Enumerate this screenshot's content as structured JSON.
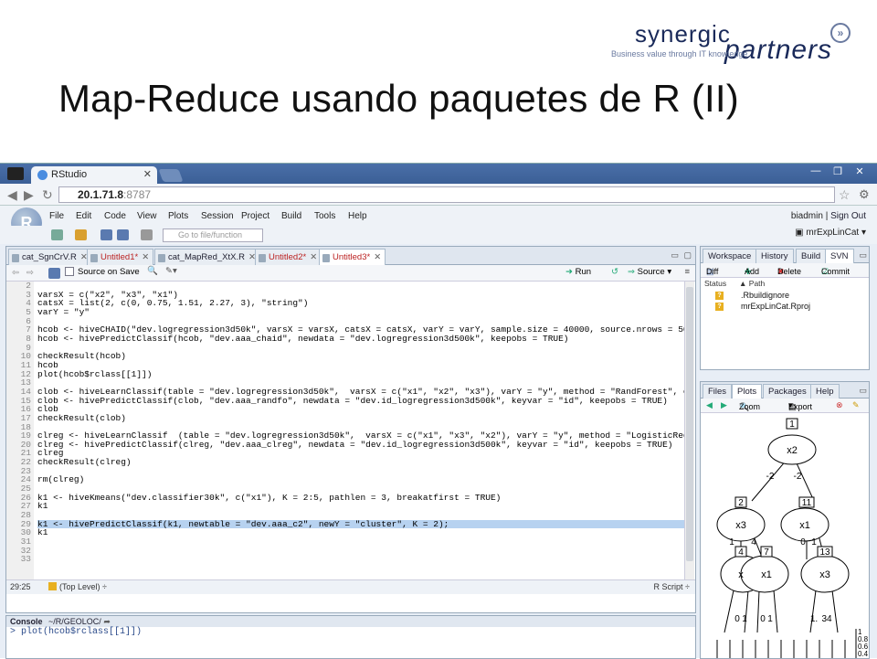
{
  "slide": {
    "title": "Map-Reduce usando paquetes de R (II)"
  },
  "logo": {
    "word1": "synergic",
    "word2": "partners",
    "tagline": "Business value through IT knowledge"
  },
  "browser": {
    "tab_title": "RStudio",
    "url_host": "20.1.71.8",
    "url_port": ":8787"
  },
  "rstudio": {
    "menu": [
      "File",
      "Edit",
      "Code",
      "View",
      "Plots",
      "Session",
      "Project",
      "Build",
      "Tools",
      "Help"
    ],
    "user": "biadmin",
    "signout": "Sign Out",
    "goto_placeholder": "Go to file/function",
    "project": "mrExpLinCat",
    "source_tabs": [
      {
        "label": "cat_SgnCrV.R",
        "modified": false
      },
      {
        "label": "Untitled1*",
        "modified": true
      },
      {
        "label": "cat_MapRed_XtX.R",
        "modified": false
      },
      {
        "label": "Untitled2*",
        "modified": true
      },
      {
        "label": "Untitled3*",
        "modified": true
      }
    ],
    "source_on_save": "Source on Save",
    "run_label": "Run",
    "source_label": "Source",
    "code_lines": [
      "",
      "varsX = c(\"x2\", \"x3\", \"x1\")",
      "catsX = list(2, c(0, 0.75, 1.51, 2.27, 3), \"string\")",
      "varY = \"y\"",
      "",
      "hcob <- hiveCHAID(\"dev.logregression3d50k\", varsX = varsX, catsX = catsX, varY = varY, sample.size = 40000, source.nrows = 500",
      "hcob <- hivePredictClassif(hcob, \"dev.aaa_chaid\", newdata = \"dev.logregression3d500k\", keepobs = TRUE)",
      "",
      "checkResult(hcob)",
      "hcob",
      "plot(hcob$rclass[[1]])",
      "",
      "clob <- hiveLearnClassif(table = \"dev.logregression3d50k\",  varsX = c(\"x1\", \"x2\", \"x3\"), varY = \"y\", method = \"RandForest\", co",
      "clob <- hivePredictClassif(clob, \"dev.aaa_randfo\", newdata = \"dev.id_logregression3d500k\", keyvar = \"id\", keepobs = TRUE)",
      "clob",
      "checkResult(clob)",
      "",
      "clreg <- hiveLearnClassif  (table = \"dev.logregression3d50k\",  varsX = c(\"x1\", \"x3\", \"x2\"), varY = \"y\", method = \"LogisticReg\"",
      "clreg <- hivePredictClassif(clreg, \"dev.aaa_clreg\", newdata = \"dev.id_logregression3d500k\", keyvar = \"id\", keepobs = TRUE)",
      "clreg",
      "checkResult(clreg)",
      "",
      "rm(clreg)",
      "",
      "k1 <- hiveKmeans(\"dev.classifier30k\", c(\"x1\"), K = 2:5, pathlen = 3, breakatfirst = TRUE)",
      "k1",
      "",
      "k1 <- hivePredictClassif(k1, newtable = \"dev.aaa_c2\", newY = \"cluster\", K = 2);",
      "k1",
      "",
      "",
      "",
      "",
      ""
    ],
    "line_numbers": [
      "2",
      "3",
      "4",
      "5",
      "6",
      "7",
      "8",
      "9",
      "10",
      "11",
      "12",
      "13",
      "14",
      "15",
      "16",
      "17",
      "18",
      "19",
      "20",
      "21",
      "22",
      "23",
      "24",
      "25",
      "26",
      "27",
      "28",
      "29",
      "30",
      "31",
      "32",
      "33",
      ""
    ],
    "cursor_pos": "29:25",
    "scope": "(Top Level)",
    "file_type": "R Script",
    "console_title": "Console",
    "console_path": "~/R/GEOLOC/",
    "console_line": "> plot(hcob$rclass[[1]])",
    "wsp_tabs": [
      "Workspace",
      "History",
      "Build",
      "SVN"
    ],
    "svn_buttons": [
      "Diff",
      "Add",
      "Delete",
      "Commit"
    ],
    "svn_headers": [
      "Status",
      "Path"
    ],
    "svn_files": [
      ".Rbuildignore",
      "mrExpLinCat.Rproj"
    ],
    "plot_tabs": [
      "Files",
      "Plots",
      "Packages",
      "Help"
    ],
    "plot_buttons": [
      "Zoom",
      "Export"
    ],
    "tree_nodes": [
      {
        "id": "1",
        "label": "x2"
      },
      {
        "id": "2",
        "label": "x3"
      },
      {
        "id": "11",
        "label": "x1"
      },
      {
        "id": "4",
        "label": "x"
      },
      {
        "id": "7",
        "label": "x1"
      },
      {
        "id": "13",
        "label": "x3"
      }
    ],
    "tree_edges": [
      "-2",
      "-2",
      "1",
      "4",
      "0",
      "1",
      "0",
      "1",
      "0",
      "1",
      "1.",
      "34"
    ],
    "tree_axis": [
      "1",
      "0.8",
      "0.6",
      "0.4",
      "0.2",
      "0"
    ]
  }
}
